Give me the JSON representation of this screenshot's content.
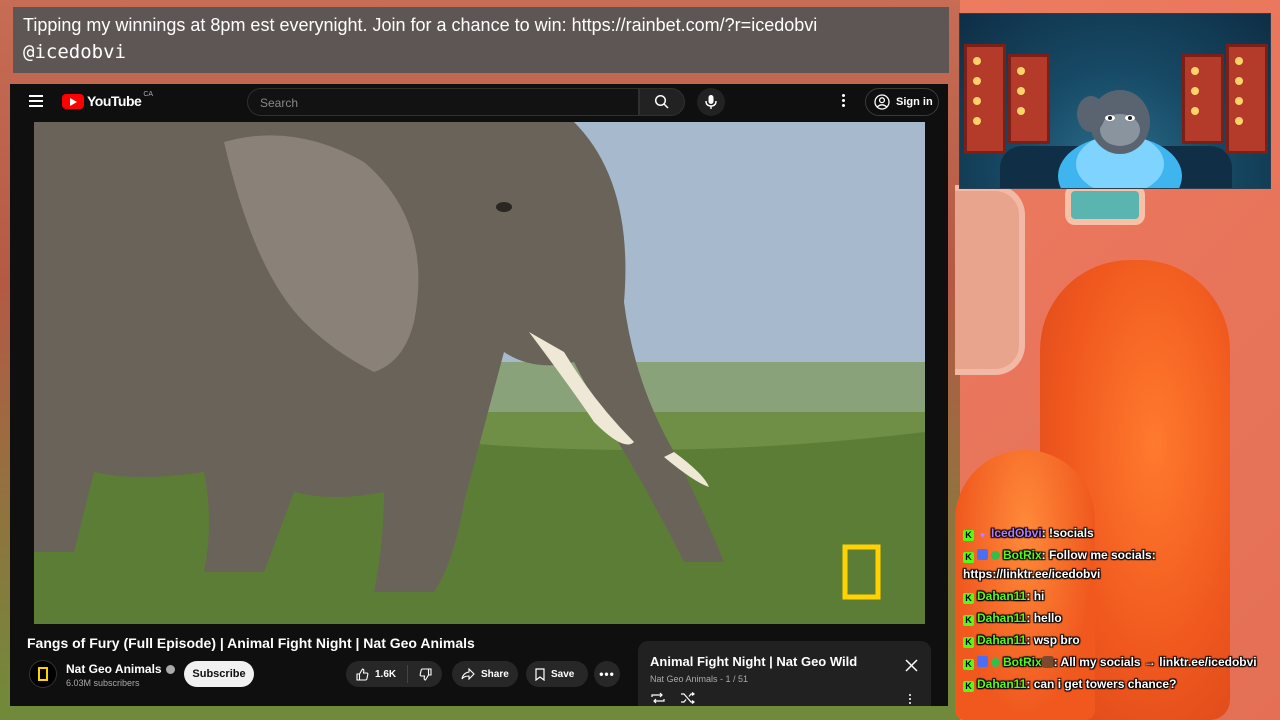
{
  "overlay": {
    "tip_line": "Tipping my winnings at 8pm est everynight. Join for a chance to win: https://rainbet.com/?r=icedobvi",
    "handle": "@icedobvi"
  },
  "youtube": {
    "logo_text": "YouTube",
    "country_code": "CA",
    "search_placeholder": "Search",
    "sign_in_label": "Sign in",
    "video_title": "Fangs of Fury (Full Episode) | Animal Fight Night | Nat Geo Animals",
    "channel_name": "Nat Geo Animals",
    "subscriber_count": "6.03M subscribers",
    "subscribe_label": "Subscribe",
    "like_count": "1.6K",
    "share_label": "Share",
    "save_label": "Save",
    "playlist": {
      "title": "Animal Fight Night | Nat Geo Wild",
      "subtitle": "Nat Geo Animals - 1 / 51"
    }
  },
  "chat": {
    "messages": [
      {
        "user": "IcedObvi",
        "text": ": !socials"
      },
      {
        "user": "BotRix",
        "text": ": Follow me socials: https://linktr.ee/icedobvi"
      },
      {
        "user": "Dahan11",
        "text": ": hi"
      },
      {
        "user": "Dahan11",
        "text": ": hello"
      },
      {
        "user": "Dahan11",
        "text": ": wsp bro"
      },
      {
        "user": "BotRix",
        "text": ": All my socials → linktr.ee/icedobvi"
      },
      {
        "user": "Dahan11",
        "text": ": can i get towers chance?"
      }
    ]
  },
  "colors": {
    "youtube_red": "#ff0000",
    "kick_green": "#53fc18",
    "streamer_purple": "#b678ff",
    "natgeo_yellow": "#ffd200"
  }
}
